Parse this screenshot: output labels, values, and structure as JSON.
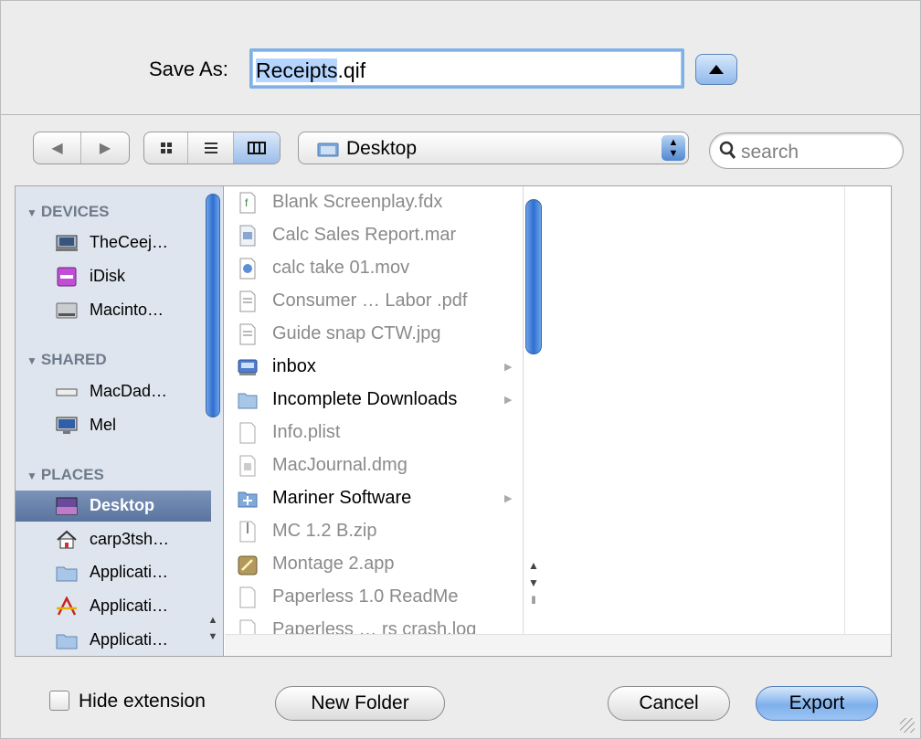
{
  "save": {
    "label": "Save As:",
    "filename_selected": "Receipts",
    "filename_ext": ".qif"
  },
  "toolbar": {
    "location": "Desktop",
    "search_placeholder": "search"
  },
  "sidebar": {
    "sections": [
      {
        "title": "DEVICES",
        "items": [
          {
            "label": "TheCeej…",
            "icon": "computer-icon"
          },
          {
            "label": "iDisk",
            "icon": "idisk-icon"
          },
          {
            "label": "Macinto…",
            "icon": "hard-drive-icon"
          }
        ]
      },
      {
        "title": "SHARED",
        "items": [
          {
            "label": "MacDad…",
            "icon": "network-server-icon"
          },
          {
            "label": "Mel",
            "icon": "monitor-icon"
          }
        ]
      },
      {
        "title": "PLACES",
        "items": [
          {
            "label": "Desktop",
            "icon": "desktop-icon",
            "selected": true
          },
          {
            "label": "carp3tsh…",
            "icon": "home-icon"
          },
          {
            "label": "Applicati…",
            "icon": "folder-icon"
          },
          {
            "label": "Applicati…",
            "icon": "applications-icon"
          },
          {
            "label": "Applicati…",
            "icon": "folder-icon"
          }
        ]
      }
    ]
  },
  "files": [
    {
      "name": "Blank Screenplay.fdx",
      "type": "file",
      "dim": true
    },
    {
      "name": "Calc Sales Report.mar",
      "type": "file",
      "dim": true
    },
    {
      "name": "calc take 01.mov",
      "type": "movie",
      "dim": true
    },
    {
      "name": "Consumer … Labor .pdf",
      "type": "file",
      "dim": true
    },
    {
      "name": "Guide snap CTW.jpg",
      "type": "file",
      "dim": true
    },
    {
      "name": "inbox",
      "type": "special-folder",
      "dim": false
    },
    {
      "name": "Incomplete Downloads",
      "type": "folder",
      "dim": false
    },
    {
      "name": "Info.plist",
      "type": "file",
      "dim": true
    },
    {
      "name": "MacJournal.dmg",
      "type": "file",
      "dim": true
    },
    {
      "name": "Mariner Software",
      "type": "folder",
      "dim": false
    },
    {
      "name": "MC 1.2 B.zip",
      "type": "zip",
      "dim": true
    },
    {
      "name": "Montage 2.app",
      "type": "app",
      "dim": true
    },
    {
      "name": "Paperless 1.0 ReadMe",
      "type": "file",
      "dim": true
    },
    {
      "name": "Paperless … rs crash.log",
      "type": "file",
      "dim": true
    }
  ],
  "bottom": {
    "hide_extension": "Hide extension",
    "new_folder": "New Folder",
    "cancel": "Cancel",
    "export": "Export"
  }
}
